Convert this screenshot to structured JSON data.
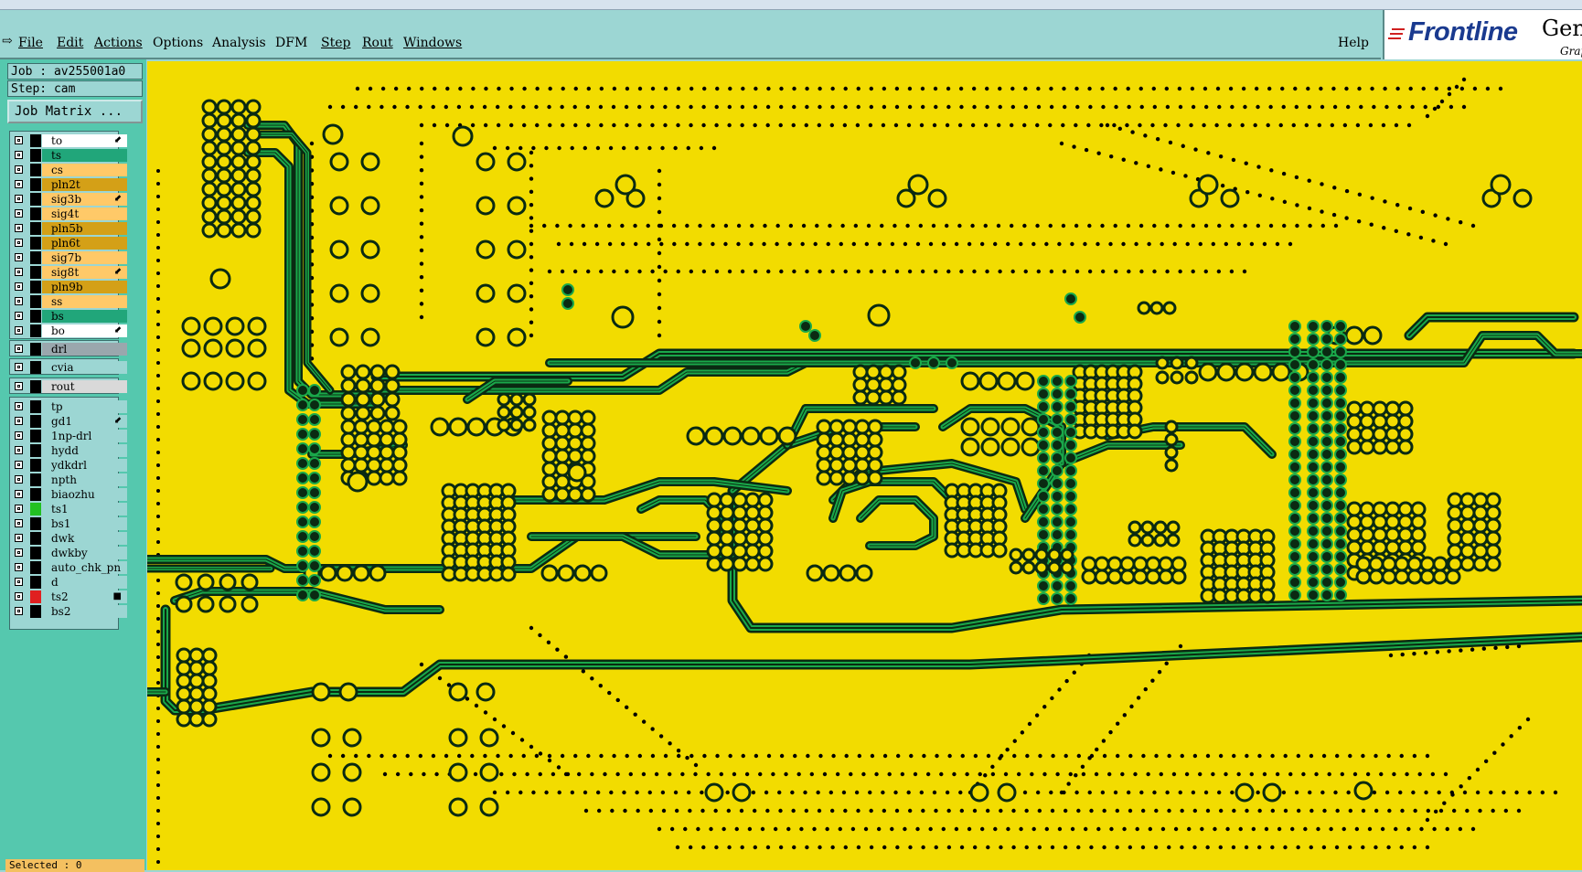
{
  "menu": {
    "items": [
      {
        "label": "File",
        "key": "file"
      },
      {
        "label": "Edit",
        "key": "edit"
      },
      {
        "label": "Actions",
        "key": "actions"
      },
      {
        "label": "Options",
        "key": "options"
      },
      {
        "label": "Analysis",
        "key": "analysis"
      },
      {
        "label": "DFM",
        "key": "dfm"
      },
      {
        "label": "Step",
        "key": "step"
      },
      {
        "label": "Rout",
        "key": "rout"
      },
      {
        "label": "Windows",
        "key": "windows"
      }
    ],
    "help_label": "Help"
  },
  "brand": {
    "logo_text": "Frontline",
    "side_text": "Gene",
    "side_sub": "Grap"
  },
  "job": {
    "job_label": "Job : av255001a0",
    "step_label": "Step: cam",
    "matrix_button": "Job Matrix ..."
  },
  "layers": {
    "board": [
      {
        "name": "to",
        "color": "#ffffff",
        "mark": "⬋"
      },
      {
        "name": "ts",
        "color": "#21a67a",
        "mark": ""
      },
      {
        "name": "cs",
        "color": "#ffc968",
        "mark": ""
      },
      {
        "name": "pln2t",
        "color": "#d4a017",
        "mark": ""
      },
      {
        "name": "sig3b",
        "color": "#ffc968",
        "mark": "⬋"
      },
      {
        "name": "sig4t",
        "color": "#ffc968",
        "mark": ""
      },
      {
        "name": "pln5b",
        "color": "#d4a017",
        "mark": ""
      },
      {
        "name": "pln6t",
        "color": "#d4a017",
        "mark": ""
      },
      {
        "name": "sig7b",
        "color": "#ffc968",
        "mark": ""
      },
      {
        "name": "sig8t",
        "color": "#ffc968",
        "mark": "⬋"
      },
      {
        "name": "pln9b",
        "color": "#d4a017",
        "mark": ""
      },
      {
        "name": "ss",
        "color": "#ffc968",
        "mark": ""
      },
      {
        "name": "bs",
        "color": "#21a67a",
        "mark": ""
      },
      {
        "name": "bo",
        "color": "#ffffff",
        "mark": "⬋"
      }
    ],
    "drill": [
      {
        "name": "drl",
        "color": "#9aa7ad",
        "mark": ""
      }
    ],
    "via": [
      {
        "name": "cvia",
        "color": "#9cd6d3",
        "mark": ""
      }
    ],
    "rout": [
      {
        "name": "rout",
        "color": "#d9d9d9",
        "mark": ""
      }
    ],
    "misc": [
      {
        "name": "tp",
        "color": "#9cd6d3",
        "swatch": "#000000",
        "mark": ""
      },
      {
        "name": "gd1",
        "color": "#9cd6d3",
        "swatch": "#000000",
        "mark": "⬋"
      },
      {
        "name": "1np-drl",
        "color": "#9cd6d3",
        "swatch": "#000000",
        "mark": ""
      },
      {
        "name": "hydd",
        "color": "#9cd6d3",
        "swatch": "#000000",
        "mark": ""
      },
      {
        "name": "ydkdrl",
        "color": "#9cd6d3",
        "swatch": "#000000",
        "mark": ""
      },
      {
        "name": "npth",
        "color": "#9cd6d3",
        "swatch": "#000000",
        "mark": ""
      },
      {
        "name": "biaozhu",
        "color": "#9cd6d3",
        "swatch": "#000000",
        "mark": ""
      },
      {
        "name": "ts1",
        "color": "#9cd6d3",
        "swatch": "#22c022",
        "mark": ""
      },
      {
        "name": "bs1",
        "color": "#9cd6d3",
        "swatch": "#000000",
        "mark": ""
      },
      {
        "name": "dwk",
        "color": "#9cd6d3",
        "swatch": "#000000",
        "mark": ""
      },
      {
        "name": "dwkby",
        "color": "#9cd6d3",
        "swatch": "#000000",
        "mark": ""
      },
      {
        "name": "auto_chk_pn",
        "color": "#9cd6d3",
        "swatch": "#000000",
        "mark": ""
      },
      {
        "name": "d",
        "color": "#9cd6d3",
        "swatch": "#000000",
        "mark": ""
      },
      {
        "name": "ts2",
        "color": "#9cd6d3",
        "swatch": "#e02020",
        "mark": "■"
      },
      {
        "name": "bs2",
        "color": "#9cd6d3",
        "swatch": "#000000",
        "mark": ""
      }
    ]
  },
  "status": {
    "selected": "Selected : 0"
  },
  "colors": {
    "board": "#f2dc00",
    "panel": "#55c8ae",
    "menu": "#9cd6d3",
    "trace": "#0a5a1a",
    "pad": "#f2dc00"
  }
}
